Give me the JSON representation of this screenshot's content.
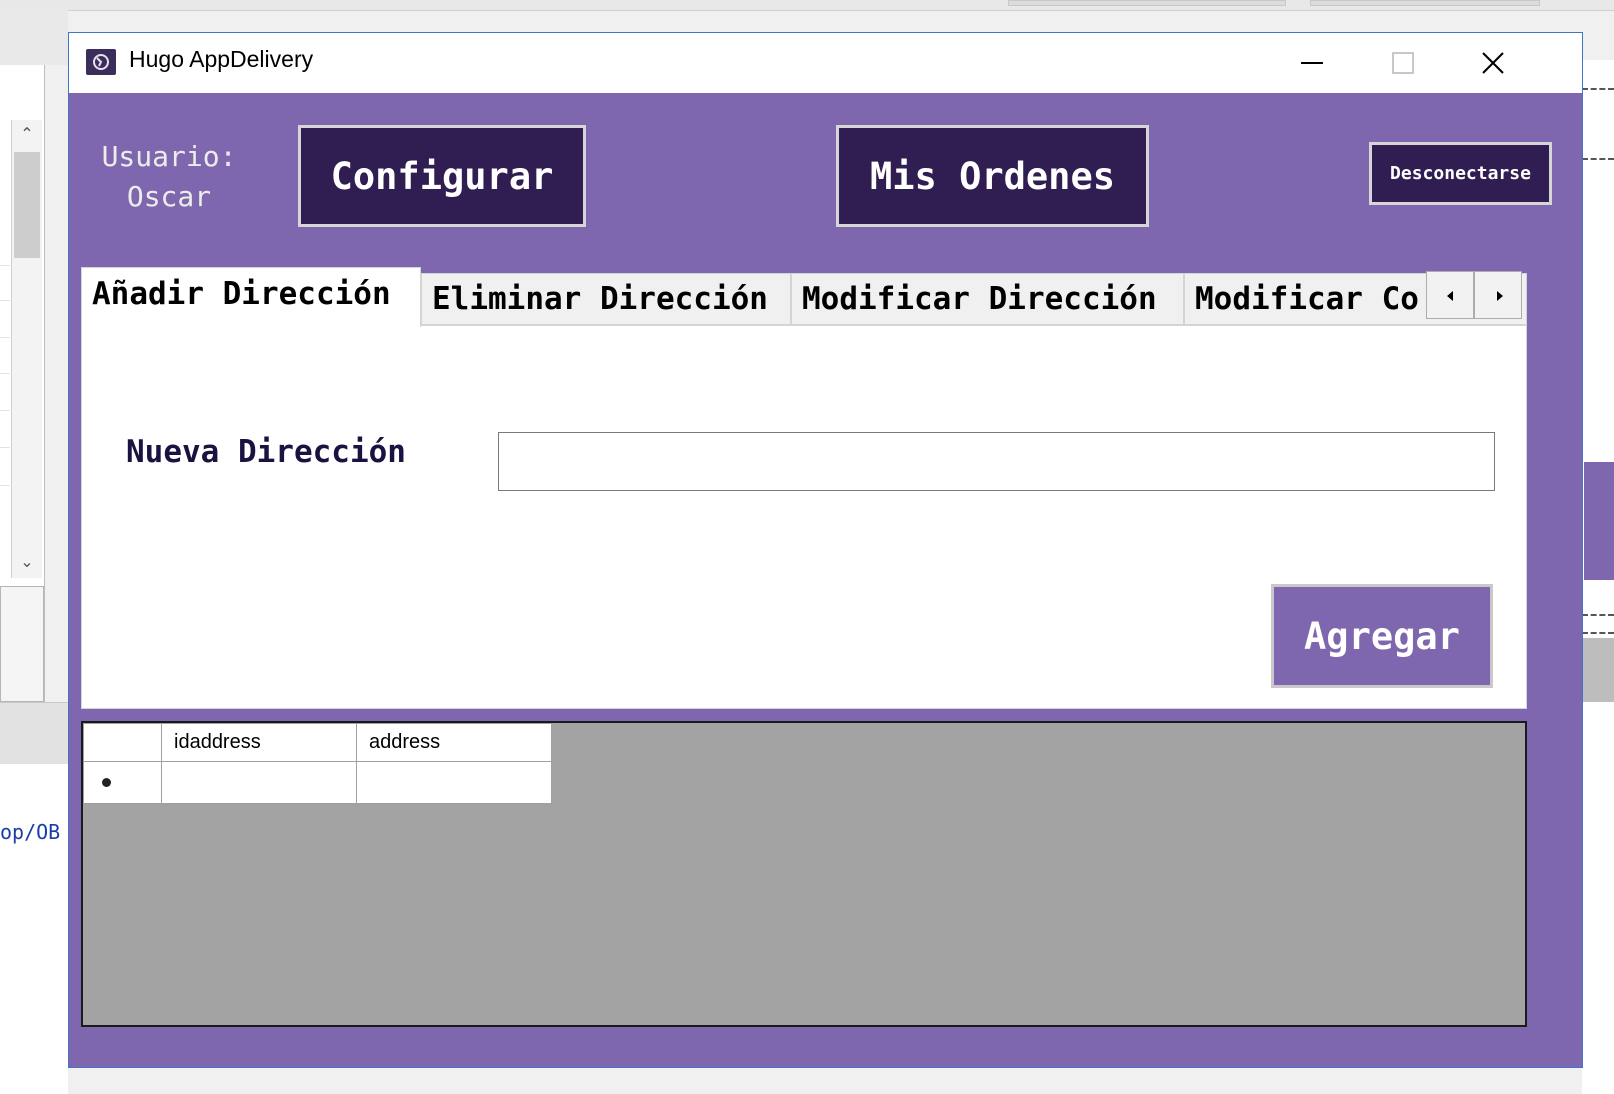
{
  "background": {
    "path_fragment": "op/OB"
  },
  "window": {
    "title": "Hugo AppDelivery"
  },
  "header": {
    "user_label_line1": "Usuario:",
    "user_label_line2": "Oscar",
    "configure_button": "Configurar",
    "orders_button": "Mis Ordenes",
    "disconnect_button": "Desconectarse"
  },
  "tabs": [
    {
      "label": "Añadir Dirección",
      "active": true
    },
    {
      "label": "Eliminar Dirección",
      "active": false
    },
    {
      "label": "Modificar Dirección",
      "active": false
    },
    {
      "label": "Modificar Co",
      "active": false
    }
  ],
  "add_panel": {
    "field_label": "Nueva Dirección",
    "field_value": "",
    "add_button": "Agregar"
  },
  "grid": {
    "columns": [
      "idaddress",
      "address"
    ],
    "rows": [
      [
        "",
        ""
      ]
    ]
  },
  "colors": {
    "window_bg": "#7e67ae",
    "dark_button": "#301d52",
    "grid_bg": "#a3a3a3"
  }
}
